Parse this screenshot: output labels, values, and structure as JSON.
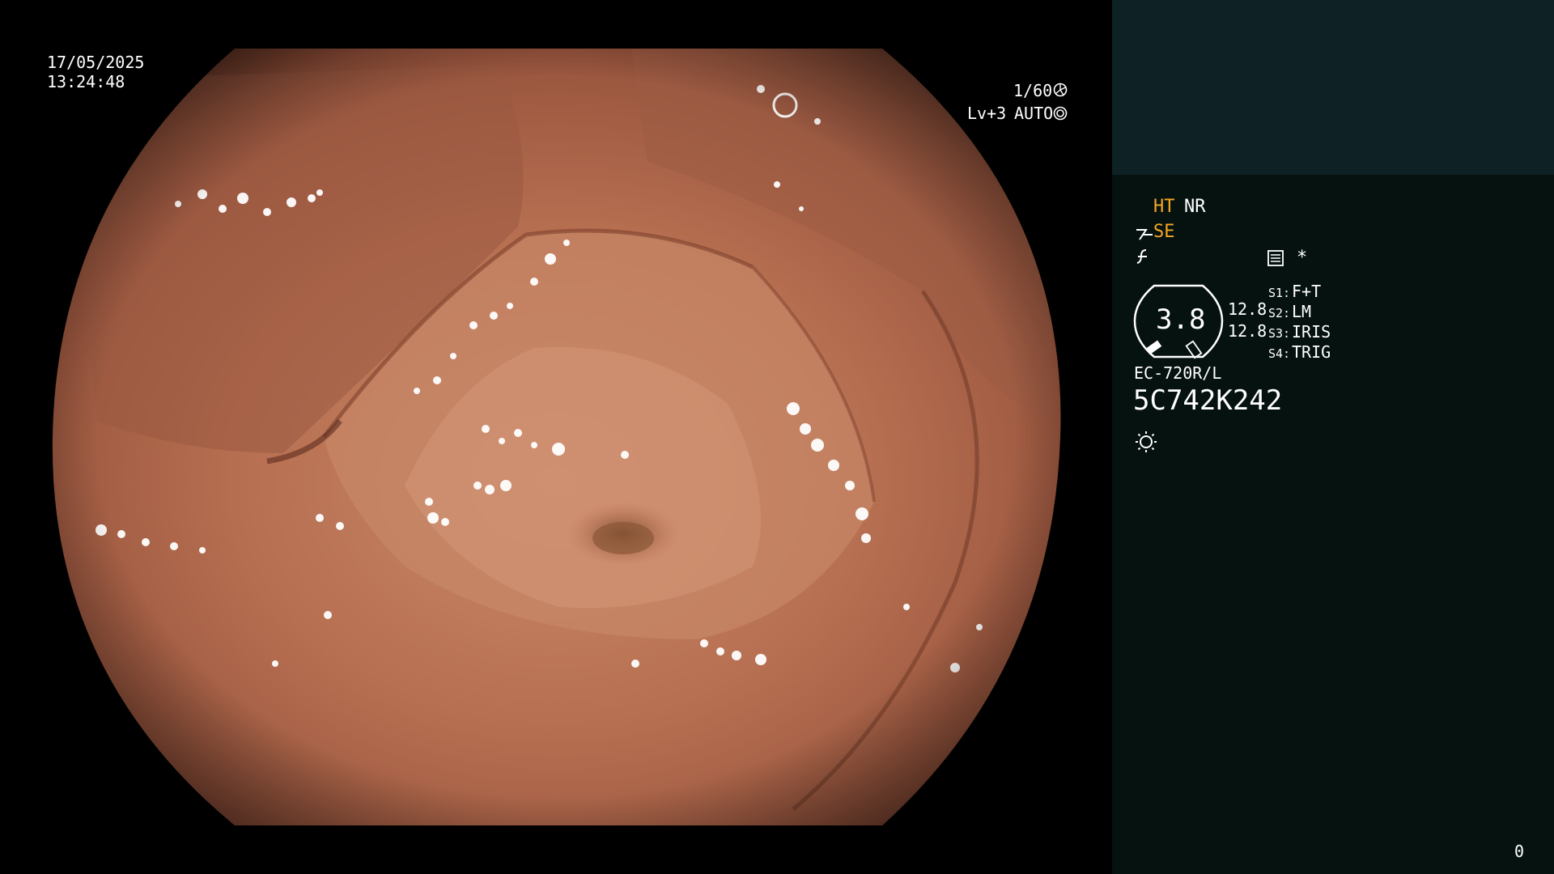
{
  "overlay": {
    "date": "17/05/2025",
    "time": "13:24:48",
    "shutter": "1/60",
    "level": "Lv+3",
    "mode": "AUTO"
  },
  "panel": {
    "ht": "HT",
    "nr": "NR",
    "se": "SE",
    "star": "*",
    "aperture_value": "3.8",
    "value_top": "12.8",
    "value_bottom": "12.8",
    "switches": [
      {
        "key": "S1:",
        "value": "F+T"
      },
      {
        "key": "S2:",
        "value": "LM"
      },
      {
        "key": "S3:",
        "value": "IRIS"
      },
      {
        "key": "S4:",
        "value": "TRIG"
      }
    ],
    "scope_model": "EC-720R/L",
    "serial": "5C742K242",
    "counter": "0"
  },
  "colors": {
    "accent_orange": "#f5a623",
    "panel_bg": "#061210",
    "panel_top_bg": "#0e2225"
  },
  "icons": [
    "shutter-icon",
    "auto-iris-icon",
    "structure-enhance-icon",
    "freeze-icon",
    "menu-icon",
    "aperture-gauge-icon",
    "light-icon"
  ]
}
